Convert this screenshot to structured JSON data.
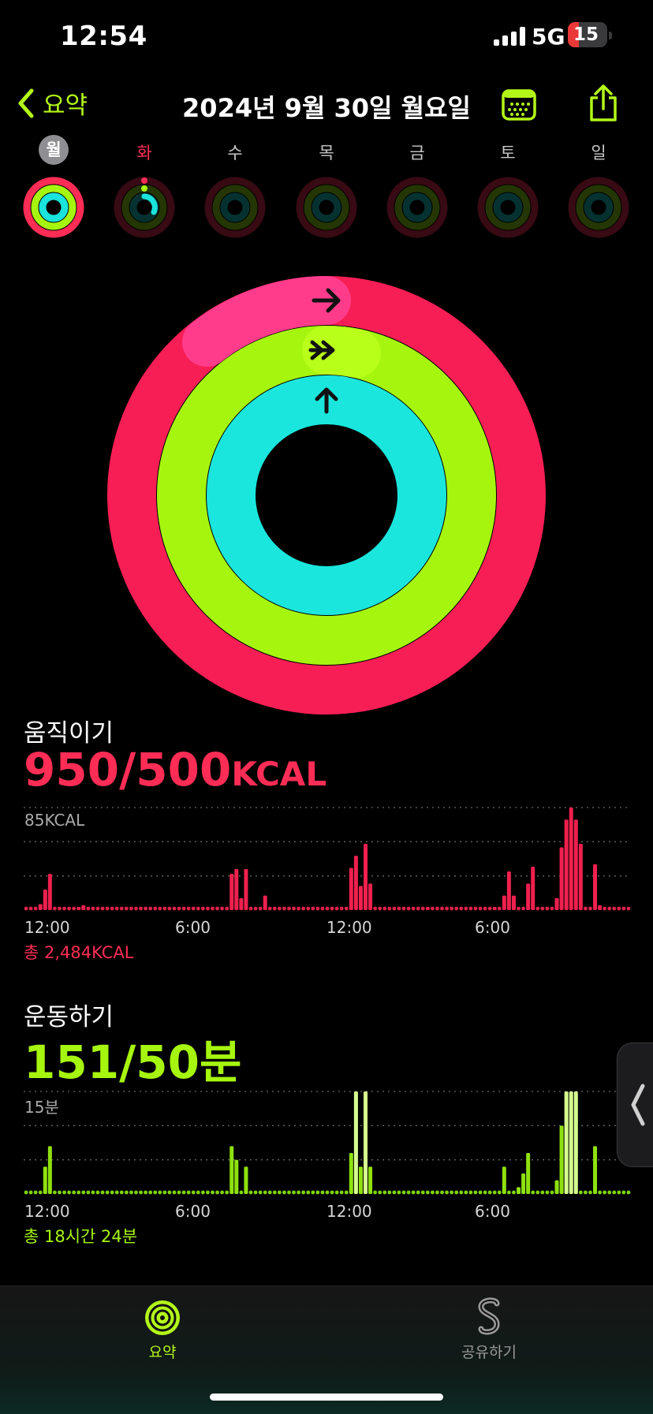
{
  "status": {
    "time": "12:54",
    "network": "5G",
    "battery": "15"
  },
  "nav": {
    "back_label": "요약",
    "title": "2024년 9월 30일 월요일"
  },
  "week": [
    {
      "label": "월",
      "state": "selected"
    },
    {
      "label": "화",
      "state": "today"
    },
    {
      "label": "수",
      "state": "none"
    },
    {
      "label": "목",
      "state": "none"
    },
    {
      "label": "금",
      "state": "none"
    },
    {
      "label": "토",
      "state": "none"
    },
    {
      "label": "일",
      "state": "none"
    }
  ],
  "colors": {
    "move": "#ff2d55",
    "exercise": "#a6f50f",
    "stand": "#19e3dc",
    "accent": "#b3f719"
  },
  "move": {
    "label": "움직이기",
    "value": "950/500",
    "unit": "KCAL",
    "progress": 1.9,
    "max_label": "85KCAL",
    "total": "총 2,484KCAL"
  },
  "exercise": {
    "label": "운동하기",
    "value": "151/50분",
    "progress": 3.02,
    "max_label": "15분",
    "total": "총 18시간 24분"
  },
  "stand": {
    "progress": 1.0
  },
  "hour_labels": [
    "12:00",
    "6:00",
    "12:00",
    "6:00"
  ],
  "chart_data": [
    {
      "type": "bar",
      "title": "",
      "ylabel": "",
      "ylim": [
        0,
        85
      ],
      "series": [
        {
          "values": [
            0,
            0,
            0,
            5,
            17,
            30,
            0,
            0,
            0,
            0,
            0,
            2,
            4,
            0,
            0,
            0,
            0,
            0,
            0,
            0,
            0,
            0,
            0,
            0,
            0,
            0,
            0,
            0,
            0,
            0,
            0,
            0,
            0,
            0,
            0,
            0,
            0,
            0,
            0,
            0,
            0,
            0,
            0,
            30,
            34,
            10,
            34,
            0,
            0,
            0,
            12,
            0,
            0,
            0,
            0,
            0,
            0,
            0,
            0,
            0,
            0,
            0,
            0,
            0,
            0,
            0,
            0,
            0,
            35,
            45,
            20,
            55,
            22,
            0,
            0,
            0,
            0,
            0,
            0,
            0,
            0,
            0,
            0,
            0,
            2,
            0,
            0,
            0,
            0,
            0,
            0,
            0,
            0,
            0,
            0,
            0,
            0,
            0,
            2,
            0,
            12,
            32,
            12,
            0,
            0,
            22,
            36,
            0,
            0,
            0,
            0,
            10,
            52,
            75,
            85,
            75,
            55,
            0,
            0,
            38,
            4,
            0,
            0,
            0,
            0,
            0,
            0
          ]
        }
      ]
    },
    {
      "type": "bar",
      "title": "",
      "ylabel": "",
      "ylim": [
        0,
        15
      ],
      "series": [
        {
          "values": [
            0,
            0,
            0,
            0,
            4,
            7,
            0,
            0,
            0,
            0,
            0,
            0,
            0,
            0,
            0,
            0,
            0,
            0,
            0,
            0,
            0,
            0,
            0,
            0,
            0,
            0,
            0,
            0,
            0,
            0,
            0,
            0,
            0,
            0,
            0,
            0,
            0,
            0,
            0,
            0,
            0,
            0,
            0,
            7,
            5,
            0,
            4,
            0,
            0,
            0,
            0,
            0,
            0,
            0,
            0,
            0,
            0,
            0,
            0,
            0,
            0,
            0,
            0,
            0,
            0,
            0,
            0,
            0,
            6,
            15,
            4,
            15,
            4,
            0,
            0,
            0,
            0,
            0,
            0,
            0,
            0,
            0,
            0,
            0,
            0,
            0,
            0,
            0,
            0,
            0,
            0,
            0,
            0,
            0,
            0,
            0,
            0,
            0,
            0,
            0,
            4,
            0,
            0,
            1,
            3,
            6,
            0,
            0,
            0,
            0,
            0,
            2,
            10,
            15,
            15,
            15,
            0,
            0,
            0,
            7,
            0,
            0,
            0,
            0,
            0,
            0,
            0
          ]
        }
      ]
    }
  ],
  "tabs": [
    {
      "label": "요약",
      "icon": "activity-rings-icon",
      "active": true
    },
    {
      "label": "공유하기",
      "icon": "sharing-icon",
      "active": false
    }
  ]
}
